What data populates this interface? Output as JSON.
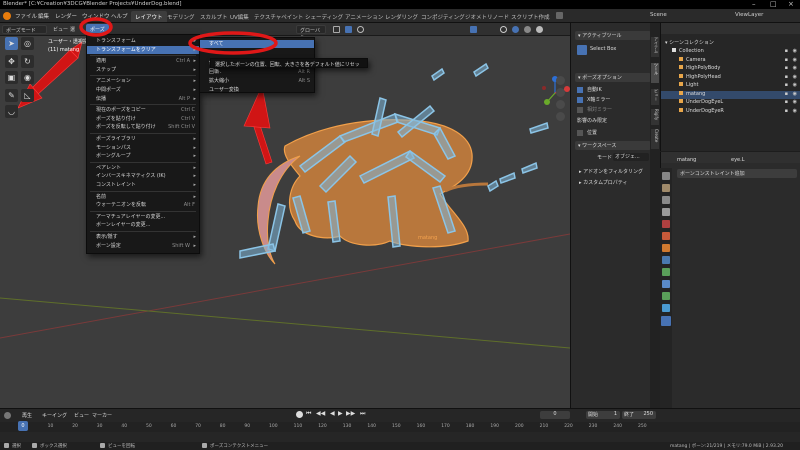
{
  "titlebar": {
    "title": "Blender* [C:¥Creation¥3DCG¥Blender Projects¥UnderDog.blend]"
  },
  "menubar": {
    "items": [
      "ファイル",
      "編集",
      "レンダー",
      "ウィンドウ",
      "ヘルプ"
    ],
    "workspaces": [
      "レイアウト",
      "モデリング",
      "スカルプト",
      "UV編集",
      "テクスチャペイント",
      "シェーディング",
      "アニメーション",
      "レンダリング",
      "コンポジティング",
      "ジオメトリノード",
      "スクリプト作成"
    ],
    "active_workspace": "レイアウト",
    "scene": "Scene",
    "view_layer": "ViewLayer"
  },
  "header3d": {
    "mode": "ポーズモード",
    "view": "ビュー",
    "select": "選",
    "pose_menu": "ポーズ",
    "transform_space": "グローバル"
  },
  "viewport": {
    "info_line1": "ユーザー・透視投影",
    "info_line2": "(11) matang",
    "object_label": "matang"
  },
  "pose_menu": {
    "items": [
      {
        "label": "トランスフォーム",
        "shortcut": "",
        "sub": true
      },
      {
        "label": "トランスフォームをクリア",
        "shortcut": "",
        "sub": true,
        "highlight": true
      },
      {
        "label": "適用",
        "shortcut": "Ctrl A",
        "sub": true
      },
      {
        "label": "ステップ",
        "shortcut": "",
        "sub": true
      },
      {
        "label": "アニメーション",
        "shortcut": "",
        "sub": true
      },
      {
        "label": "中間ポーズ",
        "shortcut": "",
        "sub": true
      },
      {
        "label": "伝播",
        "shortcut": "Alt P",
        "sub": true
      },
      {
        "label": "現在のポーズをコピー",
        "shortcut": "Ctrl C",
        "sub": false
      },
      {
        "label": "ポーズを貼り付け",
        "shortcut": "Ctrl V",
        "sub": false
      },
      {
        "label": "ポーズを反転して貼り付け",
        "shortcut": "Shift Ctrl V",
        "sub": false
      },
      {
        "label": "ポーズライブラリ",
        "shortcut": "",
        "sub": true
      },
      {
        "label": "モーションパス",
        "shortcut": "",
        "sub": true
      },
      {
        "label": "ボーングループ",
        "shortcut": "",
        "sub": true
      },
      {
        "label": "ペアレント",
        "shortcut": "",
        "sub": true
      },
      {
        "label": "インバースキネマティクス (IK)",
        "shortcut": "",
        "sub": true
      },
      {
        "label": "コンストレイント",
        "shortcut": "",
        "sub": true
      },
      {
        "label": "名前",
        "shortcut": "",
        "sub": true
      },
      {
        "label": "ウォーテニオンを反転",
        "shortcut": "Alt F",
        "sub": false
      },
      {
        "label": "アーマチュアレイヤーの変更...",
        "shortcut": "",
        "sub": false
      },
      {
        "label": "ボーンレイヤーの変更...",
        "shortcut": "",
        "sub": false
      },
      {
        "label": "表示/隠す",
        "shortcut": "",
        "sub": true
      },
      {
        "label": "ボーン設定",
        "shortcut": "Shift W",
        "sub": true
      }
    ]
  },
  "clear_submenu": {
    "items": [
      {
        "label": "すべて",
        "shortcut": "",
        "highlight": true
      },
      {
        "label": "位置",
        "shortcut": "Alt G"
      },
      {
        "label": "回転",
        "shortcut": "Alt R"
      },
      {
        "label": "拡大縮小",
        "shortcut": "Alt S"
      },
      {
        "label": "ユーザー変換",
        "shortcut": ""
      }
    ],
    "tooltip": "選択したボーンの位置、回転、大きさを各デフォルト値にリセット."
  },
  "npanel": {
    "active_tool_header": "アクティブツール",
    "tool_name": "Select Box",
    "pose_options_header": "ポーズオプション",
    "opt_auto_ik": "自動IK",
    "opt_x_mirror": "X軸ミラー",
    "opt_relative": "相対ミラー",
    "affect_only": "影響のみ限定",
    "opt_location": "位置",
    "workspace_header": "ワークスペース",
    "mode_label": "モード",
    "mode_value": "オブジェ...",
    "filter_addons": "アドオンをフィルタリング",
    "custom_props": "カスタムプロパティ",
    "tabs": [
      "アイテム",
      "ツール",
      "ビュー",
      "Rigify",
      "Create"
    ]
  },
  "outliner": {
    "header": "シーンコレクション",
    "rows": [
      {
        "label": "Collection",
        "indent": 1
      },
      {
        "label": "Camera",
        "indent": 2
      },
      {
        "label": "HighPolyBody",
        "indent": 2
      },
      {
        "label": "HighPolyHead",
        "indent": 2
      },
      {
        "label": "Light",
        "indent": 2
      },
      {
        "label": "matang",
        "indent": 2,
        "selected": true
      },
      {
        "label": "UnderDogEyeL",
        "indent": 2
      },
      {
        "label": "UnderDogEyeR",
        "indent": 2
      }
    ]
  },
  "props": {
    "object": "matang",
    "bone": "eye.L",
    "add_constraint": "ボーンコンストレイント追加"
  },
  "timeline": {
    "menus": [
      "再生",
      "キーイング",
      "ビュー",
      "マーカー"
    ],
    "current_frame": "0",
    "start_label": "開始",
    "start": "1",
    "end_label": "終了",
    "end": "250",
    "ticks": [
      "0",
      "10",
      "20",
      "30",
      "40",
      "50",
      "60",
      "70",
      "80",
      "90",
      "100",
      "110",
      "120",
      "130",
      "140",
      "150",
      "160",
      "170",
      "180",
      "190",
      "200",
      "210",
      "220",
      "230",
      "240",
      "250"
    ]
  },
  "statusbar": {
    "select": "選択",
    "box_select": "ボックス選択",
    "rotate_view": "ビューを回転",
    "context_menu": "ポーズコンテクストメニュー",
    "stats": "matang | ボーン:21/219 | メモリ:79.0 MiB | 2.93.20"
  },
  "colors": {
    "accent": "#4772b3",
    "annotation_red": "#e01818",
    "bone": "#8bc4e6",
    "mesh": "#b8773c"
  }
}
